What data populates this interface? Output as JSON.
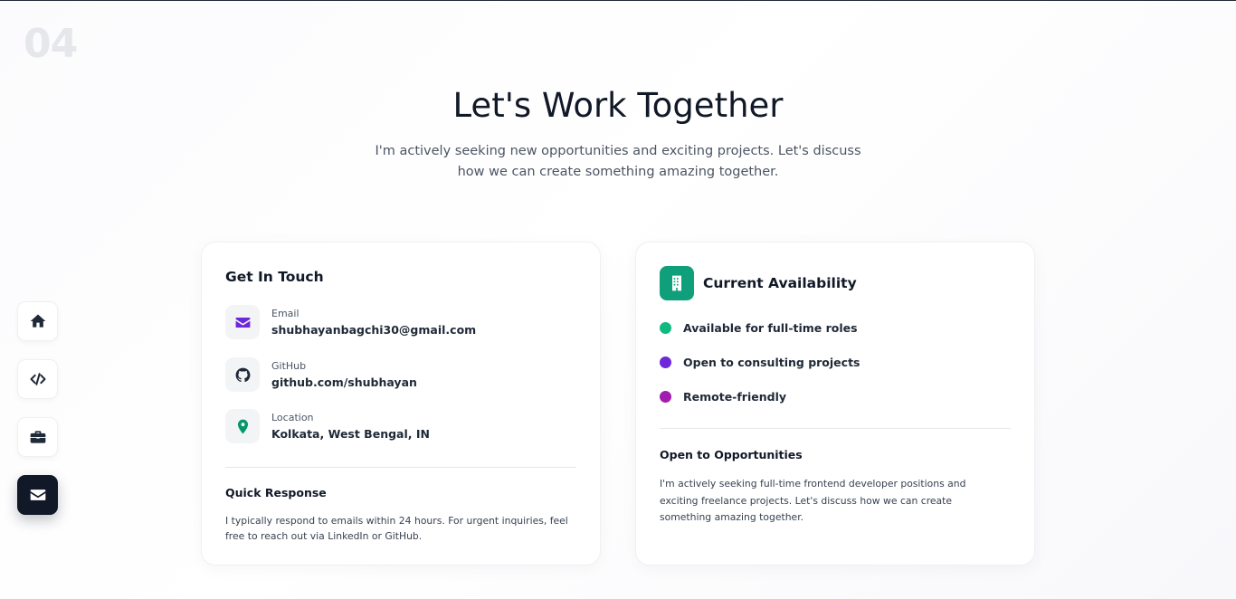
{
  "section_number": "04",
  "heading": "Let's Work Together",
  "subheading": "I'm actively seeking new opportunities and exciting projects. Let's discuss how we can create something amazing together.",
  "dock": {
    "items": [
      {
        "icon": "home-icon",
        "active": false
      },
      {
        "icon": "code-icon",
        "active": false
      },
      {
        "icon": "briefcase-icon",
        "active": false
      },
      {
        "icon": "envelope-icon",
        "active": true
      }
    ]
  },
  "contact_card": {
    "title": "Get In Touch",
    "items": [
      {
        "label": "Email",
        "value": "shubhayanbagchi30@gmail.com",
        "icon": "envelope-icon",
        "icon_color": "#6d28d9"
      },
      {
        "label": "GitHub",
        "value": "github.com/shubhayan",
        "icon": "github-icon",
        "icon_color": "#1f2937"
      },
      {
        "label": "Location",
        "value": "Kolkata, West Bengal, IN",
        "icon": "map-pin-icon",
        "icon_color": "#059669"
      }
    ],
    "quick_response_title": "Quick Response",
    "quick_response_text": "I typically respond to emails within 24 hours. For urgent inquiries, feel free to reach out via LinkedIn or GitHub."
  },
  "availability_card": {
    "title": "Current Availability",
    "icon": "building-icon",
    "icon_bg": "#0f9f7a",
    "statuses": [
      {
        "label": "Available for full-time roles",
        "color": "#10b981"
      },
      {
        "label": "Open to consulting projects",
        "color": "#6d28d9"
      },
      {
        "label": "Remote-friendly",
        "color": "#a21caf"
      }
    ],
    "opportunities_title": "Open to Opportunities",
    "opportunities_text": "I'm actively seeking full-time frontend developer positions and exciting freelance projects. Let's discuss how we can create something amazing together."
  }
}
